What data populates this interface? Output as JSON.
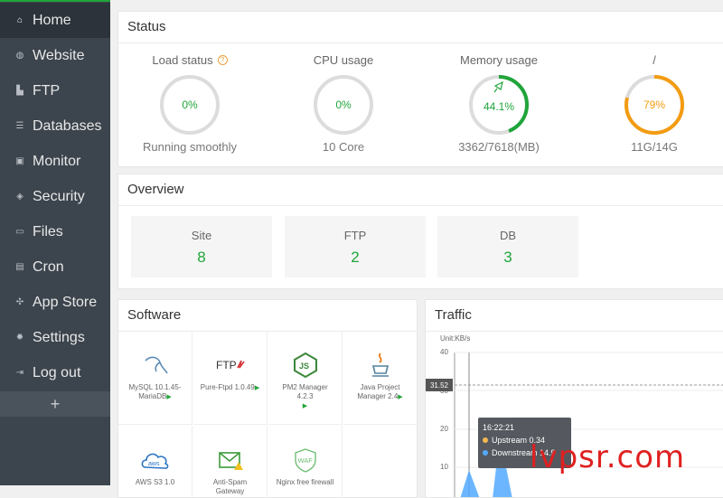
{
  "sidebar": {
    "items": [
      {
        "label": "Home",
        "icon": "home-icon"
      },
      {
        "label": "Website",
        "icon": "globe-icon"
      },
      {
        "label": "FTP",
        "icon": "ftp-icon"
      },
      {
        "label": "Databases",
        "icon": "database-icon"
      },
      {
        "label": "Monitor",
        "icon": "monitor-icon"
      },
      {
        "label": "Security",
        "icon": "shield-icon"
      },
      {
        "label": "Files",
        "icon": "folder-icon"
      },
      {
        "label": "Cron",
        "icon": "calendar-icon"
      },
      {
        "label": "App Store",
        "icon": "app-store-icon"
      },
      {
        "label": "Settings",
        "icon": "gear-icon"
      },
      {
        "label": "Log out",
        "icon": "logout-icon"
      }
    ],
    "add_label": "+"
  },
  "status": {
    "title": "Status",
    "load": {
      "label": "Load status",
      "value": "0%",
      "sub": "Running smoothly",
      "percent": 0
    },
    "cpu": {
      "label": "CPU usage",
      "value": "0%",
      "sub": "10 Core",
      "percent": 0
    },
    "memory": {
      "label": "Memory usage",
      "value": "44.1%",
      "sub": "3362/7618(MB)",
      "percent": 44.1
    },
    "disk": {
      "label": "/",
      "value": "79%",
      "sub": "11G/14G",
      "percent": 79
    }
  },
  "overview": {
    "title": "Overview",
    "items": [
      {
        "label": "Site",
        "value": "8"
      },
      {
        "label": "FTP",
        "value": "2"
      },
      {
        "label": "DB",
        "value": "3"
      }
    ]
  },
  "software": {
    "title": "Software",
    "items": [
      {
        "name": "MySQL 10.1.45-MariaDB",
        "icon": "mysql-icon"
      },
      {
        "name": "Pure-Ftpd 1.0.49",
        "icon": "ftp-logo-icon"
      },
      {
        "name": "PM2 Manager 4.2.3",
        "icon": "nodejs-icon"
      },
      {
        "name": "Java Project Manager 2.4",
        "icon": "java-icon"
      },
      {
        "name": "AWS S3 1.0",
        "icon": "aws-icon"
      },
      {
        "name": "Anti-Spam Gateway",
        "icon": "mail-gateway-icon"
      },
      {
        "name": "Nginx free firewall",
        "icon": "waf-icon"
      }
    ],
    "play_symbol": "▶"
  },
  "traffic": {
    "title": "Traffic",
    "unit": "Unit:KB/s",
    "y_ticks": [
      "40",
      "30",
      "20",
      "10"
    ],
    "marker": "31.52",
    "tooltip": {
      "time": "16:22:21",
      "upstream_label": "Upstream",
      "upstream_value": "0.34",
      "downstream_label": "Downstream",
      "downstream_value": "14.9"
    },
    "colors": {
      "upstream": "#f7b851",
      "downstream": "#52a9ff"
    }
  },
  "watermark": "lvpsr.com",
  "colors": {
    "accent": "#20a53a",
    "disk": "#f39c12",
    "sidebar": "#3c444d"
  }
}
